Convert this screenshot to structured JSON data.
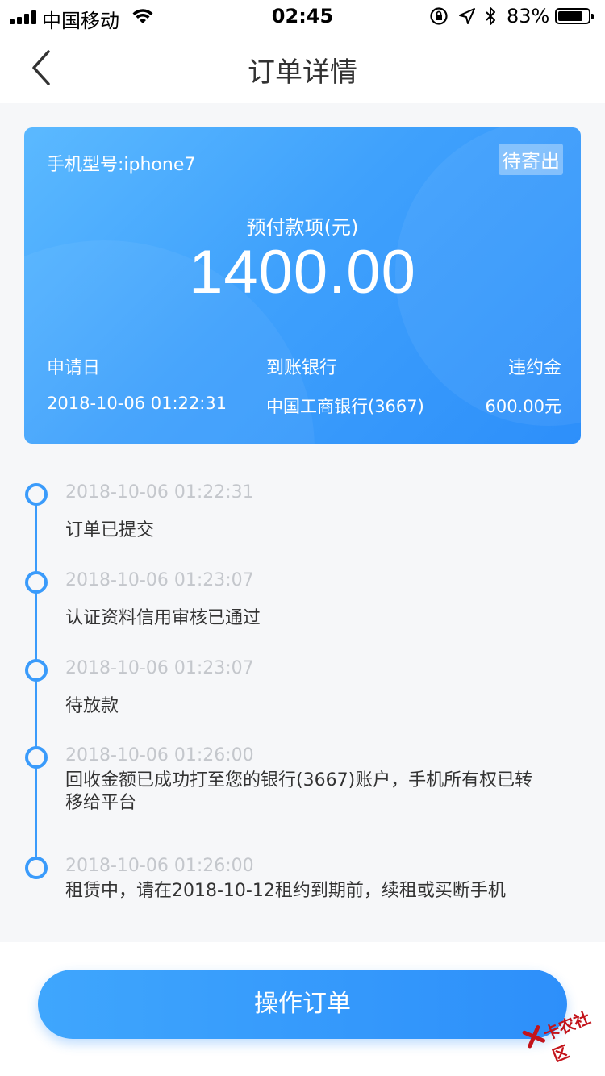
{
  "status_bar": {
    "carrier": "中国移动",
    "time": "02:45",
    "battery": "83%",
    "battery_level": 0.83
  },
  "nav": {
    "title": "订单详情",
    "back_icon": "chevron-left-icon"
  },
  "card": {
    "model": "手机型号:iphone7",
    "status": "待寄出",
    "amount_label": "预付款项(元)",
    "amount": "1400.00",
    "apply_date_label": "申请日",
    "apply_date": "2018-10-06 01:22:31",
    "bank_label": "到账银行",
    "bank": "中国工商银行(3667)",
    "penalty_label": "违约金",
    "penalty": "600.00元"
  },
  "timeline": [
    {
      "time": "2018-10-06 01:22:31",
      "text": "订单已提交"
    },
    {
      "time": "2018-10-06 01:23:07",
      "text": "认证资料信用审核已通过"
    },
    {
      "time": "2018-10-06 01:23:07",
      "text": "待放款"
    },
    {
      "time": "2018-10-06 01:26:00",
      "text": "回收金额已成功打至您的银行(3667)账户，手机所有权已转移给平台"
    },
    {
      "time": "2018-10-06 01:26:00",
      "text": "租赁中，请在2018-10-12租约到期前，续租或买断手机"
    }
  ],
  "action_button": "操作订单",
  "watermark": "卡农社区",
  "colors": {
    "accent": "#3a9bfb",
    "card_start": "#5bb9ff",
    "card_end": "#2d8ffa",
    "muted": "#c4c7cc"
  }
}
